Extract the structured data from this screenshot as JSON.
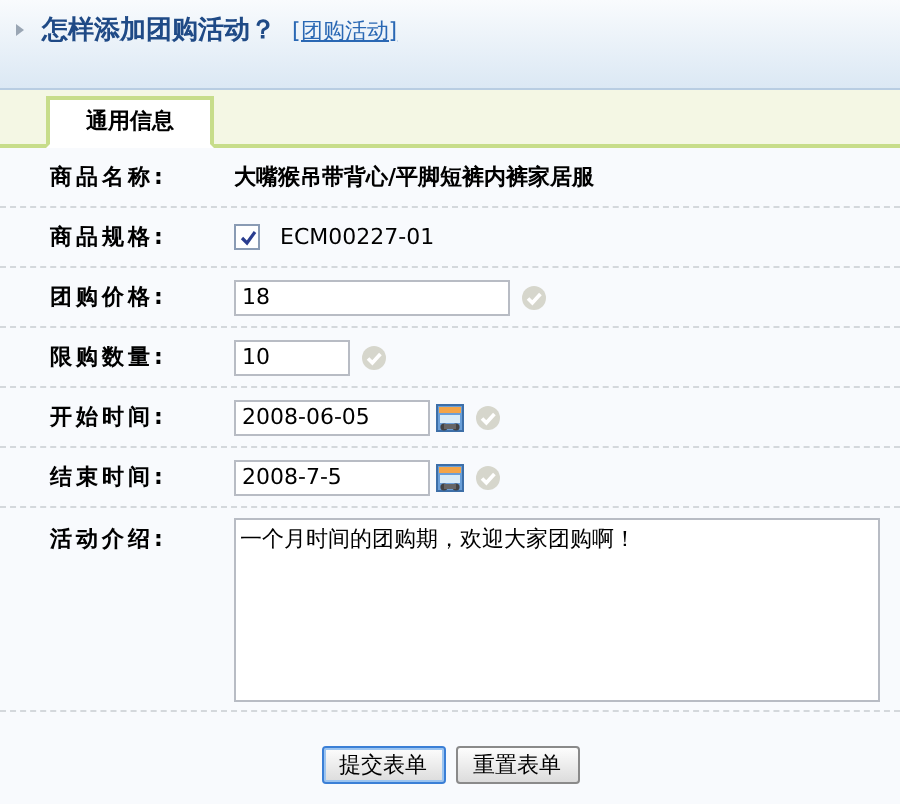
{
  "header": {
    "title": "怎样添加团购活动？",
    "link": "[团购活动]"
  },
  "tabs": [
    {
      "label": "通用信息",
      "selected": true
    }
  ],
  "fields": [
    {
      "kind": "text",
      "label": "商品名称:",
      "value": "大嘴猴吊带背心/平脚短裤内裤家居服"
    },
    {
      "kind": "checkbox",
      "label": "商品规格:",
      "value": "ECM00227-01",
      "checked": true
    },
    {
      "kind": "input",
      "label": "团购价格:",
      "value": "18",
      "valid": true
    },
    {
      "kind": "short_input",
      "label": "限购数量:",
      "value": "10",
      "valid": true
    },
    {
      "kind": "date",
      "label": "开始时间:",
      "value": "2008-06-05",
      "valid": true
    },
    {
      "kind": "date",
      "label": "结束时间:",
      "value": "2008-7-5",
      "valid": true
    },
    {
      "kind": "textarea",
      "label": "活动介绍:",
      "value": "一个月时间的团购期，欢迎大家团购啊！"
    }
  ],
  "buttons": [
    {
      "label": "提交表单",
      "focused": true
    },
    {
      "label": "重置表单",
      "focused": false
    }
  ]
}
